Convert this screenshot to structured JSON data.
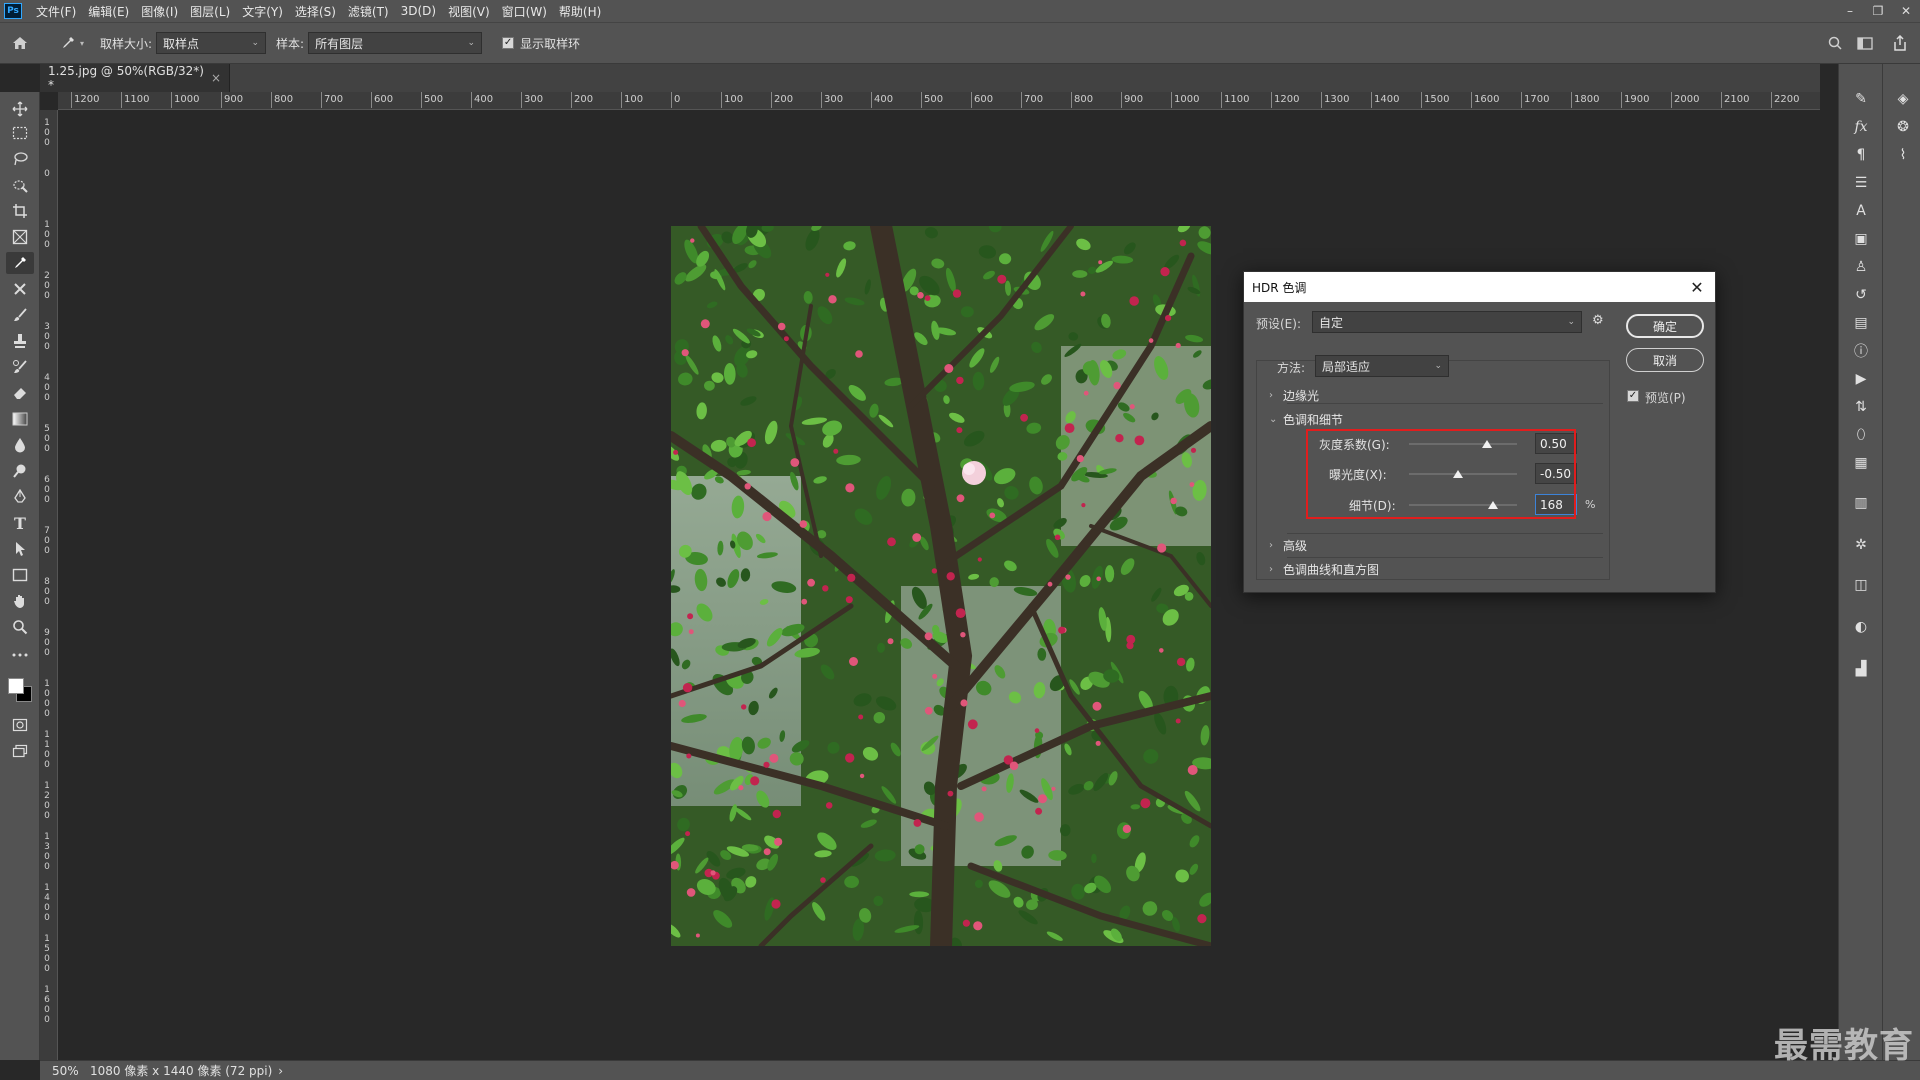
{
  "app": {
    "logo": "Ps",
    "menu": [
      "文件(F)",
      "编辑(E)",
      "图像(I)",
      "图层(L)",
      "文字(Y)",
      "选择(S)",
      "滤镜(T)",
      "3D(D)",
      "视图(V)",
      "窗口(W)",
      "帮助(H)"
    ],
    "window_controls": [
      "–",
      "❐",
      "✕"
    ]
  },
  "options_bar": {
    "sample_size_label": "取样大小:",
    "sample_size_value": "取样点",
    "sample_label": "样本:",
    "sample_value": "所有图层",
    "show_ring_label": "显示取样环",
    "show_ring_checked": true
  },
  "document": {
    "tab_title": "1.25.jpg @ 50%(RGB/32*) *",
    "tab_close": "×"
  },
  "ruler": {
    "horizontal": [
      "1200",
      "1100",
      "1000",
      "900",
      "800",
      "700",
      "600",
      "500",
      "400",
      "300",
      "200",
      "100",
      "0",
      "100",
      "200",
      "300",
      "400",
      "500",
      "600",
      "700",
      "800",
      "900",
      "1000",
      "1100",
      "1200",
      "1300",
      "1400",
      "1500",
      "1600",
      "1700",
      "1800",
      "1900",
      "2000",
      "2100",
      "2200"
    ],
    "vertical": [
      "100",
      "0",
      "100",
      "200",
      "300",
      "400",
      "500",
      "600",
      "700",
      "800",
      "900",
      "1000",
      "1100",
      "1200",
      "1300",
      "1400",
      "1500",
      "1600"
    ]
  },
  "status": {
    "zoom": "50%",
    "doc_info": "1080 像素 x 1440 像素 (72 ppi)",
    "arrow": "›"
  },
  "dialog": {
    "title": "HDR 色调",
    "preset_label": "预设(E):",
    "preset_value": "自定",
    "method_label": "方法:",
    "method_value": "局部适应",
    "ok_label": "确定",
    "cancel_label": "取消",
    "preview_label": "预览(P)",
    "preview_checked": true,
    "sections": {
      "edge_glow": "边缘光",
      "tone_detail": "色调和细节",
      "advanced": "高级",
      "curve_histogram": "色调曲线和直方图"
    },
    "sliders": [
      {
        "label": "灰度系数(G):",
        "value": "0.50",
        "position": 0.72
      },
      {
        "label": "曝光度(X):",
        "value": "-0.50",
        "position": 0.45
      },
      {
        "label": "细节(D):",
        "value": "168",
        "unit": "%",
        "position": 0.78
      }
    ]
  },
  "watermark": "最需教育"
}
